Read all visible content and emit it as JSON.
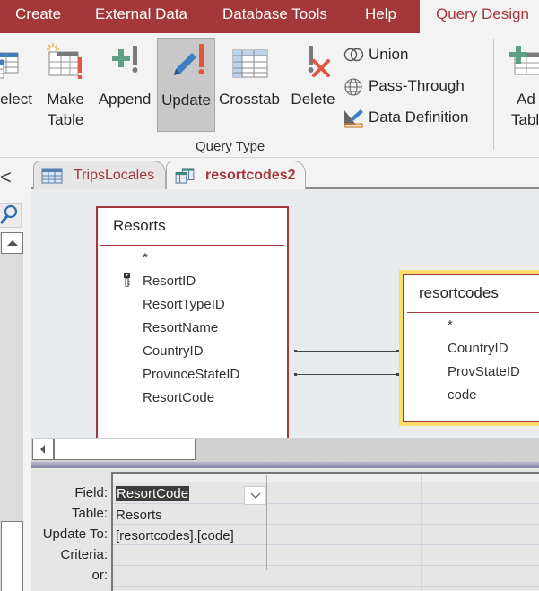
{
  "ribbon": {
    "tabs": [
      {
        "label": "Create",
        "active": false
      },
      {
        "label": "External Data",
        "active": false
      },
      {
        "label": "Database Tools",
        "active": false
      },
      {
        "label": "Help",
        "active": false
      },
      {
        "label": "Query Design",
        "active": true
      }
    ],
    "query_type_buttons": [
      {
        "label": "elect",
        "icon": "select-query-icon"
      },
      {
        "label": "Make Table",
        "icon": "make-table-icon"
      },
      {
        "label": "Append",
        "icon": "append-icon"
      },
      {
        "label": "Update",
        "icon": "update-icon",
        "pressed": true
      },
      {
        "label": "Crosstab",
        "icon": "crosstab-icon"
      },
      {
        "label": "Delete",
        "icon": "delete-icon"
      }
    ],
    "small_buttons": [
      {
        "label": "Union",
        "icon": "union-icon"
      },
      {
        "label": "Pass-Through",
        "icon": "globe-icon"
      },
      {
        "label": "Data Definition",
        "icon": "data-definition-icon"
      }
    ],
    "group_label": "Query Type",
    "add_tables": {
      "line1": "Ad",
      "line2": "Tabl"
    }
  },
  "nav_pane": {
    "collapse_glyph": "<"
  },
  "document_tabs": [
    {
      "label": "TripsLocales",
      "icon": "table-icon",
      "active": false
    },
    {
      "label": "resortcodes2",
      "icon": "query-icon",
      "active": true
    }
  ],
  "design": {
    "tables": [
      {
        "name": "Resorts",
        "fields": [
          "*",
          "ResortID",
          "ResortTypeID",
          "ResortName",
          "CountryID",
          "ProvinceStateID",
          "ResortCode"
        ],
        "primary_key": "ResortID",
        "selected": false
      },
      {
        "name": "resortcodes",
        "fields": [
          "*",
          "CountryID",
          "ProvStateID",
          "code"
        ],
        "selected": true
      }
    ],
    "joins": [
      {
        "from": "Resorts.CountryID",
        "to": "resortcodes.CountryID"
      },
      {
        "from": "Resorts.ProvinceStateID",
        "to": "resortcodes.ProvStateID"
      }
    ]
  },
  "grid": {
    "row_labels": [
      "Field:",
      "Table:",
      "Update To:",
      "Criteria:",
      "or:"
    ],
    "columns": [
      {
        "field": "ResortCode",
        "table": "Resorts",
        "update_to": "[resortcodes].[code]",
        "criteria": "",
        "or": ""
      },
      {
        "field": "",
        "table": "",
        "update_to": "",
        "criteria": "",
        "or": ""
      }
    ]
  },
  "colors": {
    "accent": "#a4373a",
    "selected_table_highlight": "#fddc6a",
    "canvas_bg": "#e9ecef",
    "ribbon_bg": "#f3f3f3"
  }
}
